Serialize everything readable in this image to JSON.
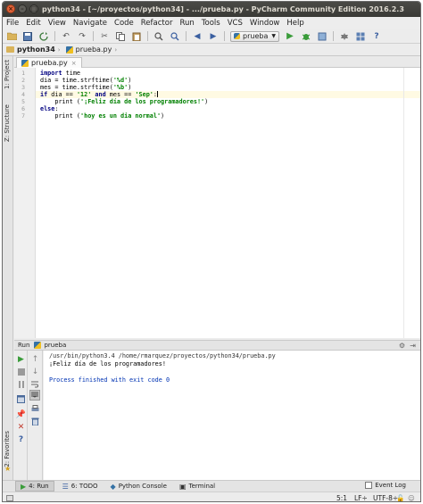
{
  "window": {
    "title": "python34 - [~/proyectos/python34] - .../prueba.py - PyCharm Community Edition 2016.2.3"
  },
  "menu": {
    "items": [
      "File",
      "Edit",
      "View",
      "Navigate",
      "Code",
      "Refactor",
      "Run",
      "Tools",
      "VCS",
      "Window",
      "Help"
    ]
  },
  "toolbar": {
    "run_config": "prueba"
  },
  "navbar": {
    "project": "python34",
    "file": "prueba.py"
  },
  "sidebar": {
    "project_tab": "1: Project",
    "structure_tab": "Z: Structure",
    "favorites_tab": "2: Favorites"
  },
  "editor": {
    "tab_label": "prueba.py",
    "line_numbers": [
      "1",
      "2",
      "3",
      "4",
      "5",
      "6",
      "7"
    ],
    "current_line": 4,
    "lines": [
      [
        {
          "k": "kw",
          "t": "import"
        },
        {
          "k": "",
          "t": " time"
        }
      ],
      [
        {
          "k": "",
          "t": "dia = time.strftime("
        },
        {
          "k": "str",
          "t": "'%d'"
        },
        {
          "k": "",
          "t": ")"
        }
      ],
      [
        {
          "k": "",
          "t": "mes = time.strftime("
        },
        {
          "k": "str",
          "t": "'%b'"
        },
        {
          "k": "",
          "t": ")"
        }
      ],
      [
        {
          "k": "kw",
          "t": "if"
        },
        {
          "k": "",
          "t": " dia == "
        },
        {
          "k": "str",
          "t": "'12'"
        },
        {
          "k": "",
          "t": " "
        },
        {
          "k": "kw",
          "t": "and"
        },
        {
          "k": "",
          "t": " mes == "
        },
        {
          "k": "str",
          "t": "'Sep'"
        },
        {
          "k": "",
          "t": ":"
        }
      ],
      [
        {
          "k": "",
          "t": "    print ("
        },
        {
          "k": "str",
          "t": "'¡Feliz día de los programadores!'"
        },
        {
          "k": "",
          "t": ")"
        }
      ],
      [
        {
          "k": "kw",
          "t": "else"
        },
        {
          "k": "",
          "t": ":"
        }
      ],
      [
        {
          "k": "",
          "t": "    print ("
        },
        {
          "k": "str",
          "t": "'hoy es un dia normal'"
        },
        {
          "k": "",
          "t": ")"
        }
      ]
    ]
  },
  "run_panel": {
    "label": "Run",
    "config": "prueba",
    "console": {
      "command": "/usr/bin/python3.4 /home/rmarquez/proyectos/python34/prueba.py",
      "output": "¡Feliz día de los programadores!",
      "exit": "Process finished with exit code 0"
    }
  },
  "bottom_tabs": {
    "run": "4: Run",
    "todo": "6: TODO",
    "python_console": "Python Console",
    "terminal": "Terminal",
    "event_log": "Event Log"
  },
  "status": {
    "position": "5:1",
    "line_sep": "LF÷",
    "encoding": "UTF-8÷"
  },
  "colors": {
    "keyword": "#000080",
    "string": "#008000",
    "current_line": "#fffae3",
    "run_green": "#3a9c3a",
    "stop_red": "#c0392b"
  }
}
